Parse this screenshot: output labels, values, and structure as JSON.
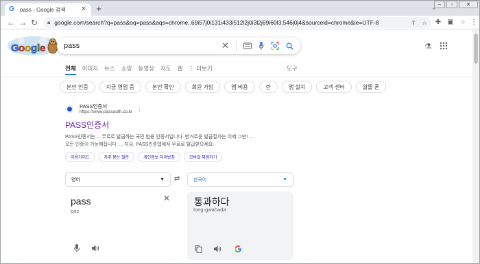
{
  "browser": {
    "tab_title": "pass - Google 검색",
    "tab_favicon": "G",
    "tab_close": "✕",
    "new_tab": "+",
    "url": "google.com/search?q=pass&oq=pass&aqs=chrome..69i57j0i131i433i512l2j0i3l2j69i60l3.546j0j4&sourceid=chrome&ie=UTF-8"
  },
  "search": {
    "query": "pass"
  },
  "tabs": [
    {
      "label": "전체",
      "active": true
    },
    {
      "label": "이미지"
    },
    {
      "label": "뉴스"
    },
    {
      "label": "쇼핑"
    },
    {
      "label": "동영상"
    },
    {
      "label": "지도"
    },
    {
      "label": "웹"
    },
    {
      "label": "⋮ 더보기"
    }
  ],
  "tools_label": "도구",
  "chips": [
    "본인 인증",
    "지금 영업 중",
    "본인 확인",
    "회원 가입",
    "앱 비용",
    "란",
    "앱 설치",
    "고객 센터",
    "알뜰 폰"
  ],
  "result": {
    "site_name": "PASS인증서",
    "site_url": "https://www.passauth.co.kr",
    "title": "PASS인증서",
    "snippet_line1": "PASS인증서는 ... 무료로 발급하는 국민 범용 인증서입니다. 번거로운 발급절차는 이제 그만! ...",
    "snippet_line2": "모든 인증이 가능해집니다. ... 지금, PASS인증앱에서 무료로 발급받으세요.",
    "sitelinks": [
      "이용가이드",
      "자주 묻는 질문",
      "개인정보 처리방침",
      "모바일 체험하기"
    ]
  },
  "translate": {
    "source_lang": "영어",
    "target_lang": "한국어",
    "source_text": "pass",
    "source_pron": "pas",
    "target_text": "통과하다",
    "target_pron": "tong-gwahada"
  },
  "colors": {
    "link_visited": "#681da8",
    "accent": "#1a73e8"
  }
}
